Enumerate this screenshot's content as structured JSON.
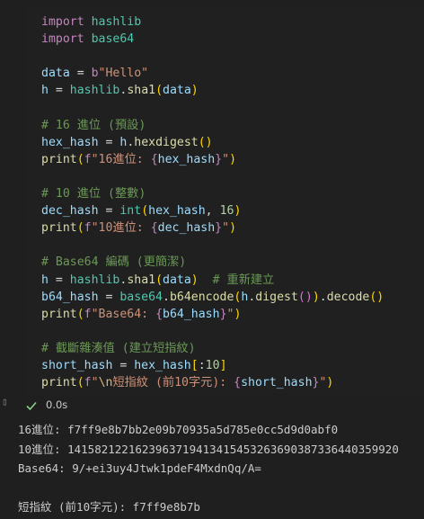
{
  "code_lines": [
    [
      {
        "t": "import",
        "c": "kw"
      },
      {
        "t": " hashlib",
        "c": "mod"
      }
    ],
    [
      {
        "t": "import",
        "c": "kw"
      },
      {
        "t": " base64",
        "c": "mod"
      }
    ],
    [],
    [
      {
        "t": "data",
        "c": "var"
      },
      {
        "t": " = ",
        "c": ""
      },
      {
        "t": "b",
        "c": "kw"
      },
      {
        "t": "\"Hello\"",
        "c": "str"
      }
    ],
    [
      {
        "t": "h",
        "c": "var"
      },
      {
        "t": " = ",
        "c": ""
      },
      {
        "t": "hashlib",
        "c": "mod"
      },
      {
        "t": ".",
        "c": ""
      },
      {
        "t": "sha1",
        "c": "fn"
      },
      {
        "t": "(",
        "c": "br1"
      },
      {
        "t": "data",
        "c": "var"
      },
      {
        "t": ")",
        "c": "br1"
      }
    ],
    [],
    [
      {
        "t": "# 16 進位 (預設)",
        "c": "cm"
      }
    ],
    [
      {
        "t": "hex_hash",
        "c": "var"
      },
      {
        "t": " = ",
        "c": ""
      },
      {
        "t": "h",
        "c": "var"
      },
      {
        "t": ".",
        "c": ""
      },
      {
        "t": "hexdigest",
        "c": "fn"
      },
      {
        "t": "()",
        "c": "br1"
      }
    ],
    [
      {
        "t": "print",
        "c": "fn"
      },
      {
        "t": "(",
        "c": "br1"
      },
      {
        "t": "f",
        "c": "kw"
      },
      {
        "t": "\"16進位: ",
        "c": "str"
      },
      {
        "t": "{",
        "c": "kw"
      },
      {
        "t": "hex_hash",
        "c": "var"
      },
      {
        "t": "}",
        "c": "kw"
      },
      {
        "t": "\"",
        "c": "str"
      },
      {
        "t": ")",
        "c": "br1"
      }
    ],
    [],
    [
      {
        "t": "# 10 進位 (整數)",
        "c": "cm"
      }
    ],
    [
      {
        "t": "dec_hash",
        "c": "var"
      },
      {
        "t": " = ",
        "c": ""
      },
      {
        "t": "int",
        "c": "mod"
      },
      {
        "t": "(",
        "c": "br1"
      },
      {
        "t": "hex_hash",
        "c": "var"
      },
      {
        "t": ", ",
        "c": ""
      },
      {
        "t": "16",
        "c": "num"
      },
      {
        "t": ")",
        "c": "br1"
      }
    ],
    [
      {
        "t": "print",
        "c": "fn"
      },
      {
        "t": "(",
        "c": "br1"
      },
      {
        "t": "f",
        "c": "kw"
      },
      {
        "t": "\"10進位: ",
        "c": "str"
      },
      {
        "t": "{",
        "c": "kw"
      },
      {
        "t": "dec_hash",
        "c": "var"
      },
      {
        "t": "}",
        "c": "kw"
      },
      {
        "t": "\"",
        "c": "str"
      },
      {
        "t": ")",
        "c": "br1"
      }
    ],
    [],
    [
      {
        "t": "# Base64 編碼 (更簡潔)",
        "c": "cm"
      }
    ],
    [
      {
        "t": "h",
        "c": "var"
      },
      {
        "t": " = ",
        "c": ""
      },
      {
        "t": "hashlib",
        "c": "mod"
      },
      {
        "t": ".",
        "c": ""
      },
      {
        "t": "sha1",
        "c": "fn"
      },
      {
        "t": "(",
        "c": "br1"
      },
      {
        "t": "data",
        "c": "var"
      },
      {
        "t": ")",
        "c": "br1"
      },
      {
        "t": "  # 重新建立",
        "c": "cm"
      }
    ],
    [
      {
        "t": "b64_hash",
        "c": "var"
      },
      {
        "t": " = ",
        "c": ""
      },
      {
        "t": "base64",
        "c": "mod"
      },
      {
        "t": ".",
        "c": ""
      },
      {
        "t": "b64encode",
        "c": "fn"
      },
      {
        "t": "(",
        "c": "br1"
      },
      {
        "t": "h",
        "c": "var"
      },
      {
        "t": ".",
        "c": ""
      },
      {
        "t": "digest",
        "c": "fn"
      },
      {
        "t": "()",
        "c": "br2"
      },
      {
        "t": ")",
        "c": "br1"
      },
      {
        "t": ".",
        "c": ""
      },
      {
        "t": "decode",
        "c": "fn"
      },
      {
        "t": "()",
        "c": "br1"
      }
    ],
    [
      {
        "t": "print",
        "c": "fn"
      },
      {
        "t": "(",
        "c": "br1"
      },
      {
        "t": "f",
        "c": "kw"
      },
      {
        "t": "\"Base64: ",
        "c": "str"
      },
      {
        "t": "{",
        "c": "kw"
      },
      {
        "t": "b64_hash",
        "c": "var"
      },
      {
        "t": "}",
        "c": "kw"
      },
      {
        "t": "\"",
        "c": "str"
      },
      {
        "t": ")",
        "c": "br1"
      }
    ],
    [],
    [
      {
        "t": "# 截斷雜湊值 (建立短指紋)",
        "c": "cm"
      }
    ],
    [
      {
        "t": "short_hash",
        "c": "var"
      },
      {
        "t": " = ",
        "c": ""
      },
      {
        "t": "hex_hash",
        "c": "var"
      },
      {
        "t": "[",
        "c": "br1"
      },
      {
        "t": ":",
        "c": ""
      },
      {
        "t": "10",
        "c": "num"
      },
      {
        "t": "]",
        "c": "br1"
      }
    ],
    [
      {
        "t": "print",
        "c": "fn"
      },
      {
        "t": "(",
        "c": "br1"
      },
      {
        "t": "f",
        "c": "kw"
      },
      {
        "t": "\"",
        "c": "str"
      },
      {
        "t": "\\n",
        "c": "esc"
      },
      {
        "t": "短指紋 (前10字元): ",
        "c": "str"
      },
      {
        "t": "{",
        "c": "kw"
      },
      {
        "t": "short_hash",
        "c": "var"
      },
      {
        "t": "}",
        "c": "kw"
      },
      {
        "t": "\"",
        "c": "str"
      },
      {
        "t": ")",
        "c": "br1"
      }
    ]
  ],
  "status": {
    "exec_time": "0.0s",
    "check_icon": "check-icon",
    "success_color": "#89d185"
  },
  "output_lines": [
    "16進位: f7ff9e8b7bb2e09b70935a5d785e0cc5d9d0abf0",
    "10進位: 1415821221623963719413415453263690387336440359920",
    "Base64: 9/+ei3uy4Jtwk1pdeF4MxdnQq/A=",
    "",
    "短指紋 (前10字元): f7ff9e8b7b"
  ]
}
